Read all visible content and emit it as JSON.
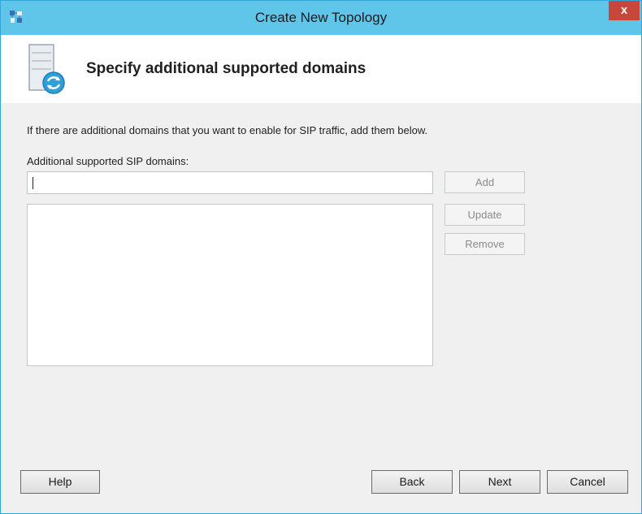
{
  "window": {
    "title": "Create New Topology",
    "close_label": "x",
    "accent": "#5fc6ea"
  },
  "header": {
    "title": "Specify additional supported domains",
    "icon": "server-sync-icon"
  },
  "content": {
    "instruction": "If there are additional domains that you want to enable for SIP traffic, add them below.",
    "field_label": "Additional supported SIP domains:",
    "input_value": "",
    "domain_list": []
  },
  "side_buttons": {
    "add": "Add",
    "update": "Update",
    "remove": "Remove"
  },
  "footer": {
    "help": "Help",
    "back": "Back",
    "next": "Next",
    "cancel": "Cancel"
  }
}
